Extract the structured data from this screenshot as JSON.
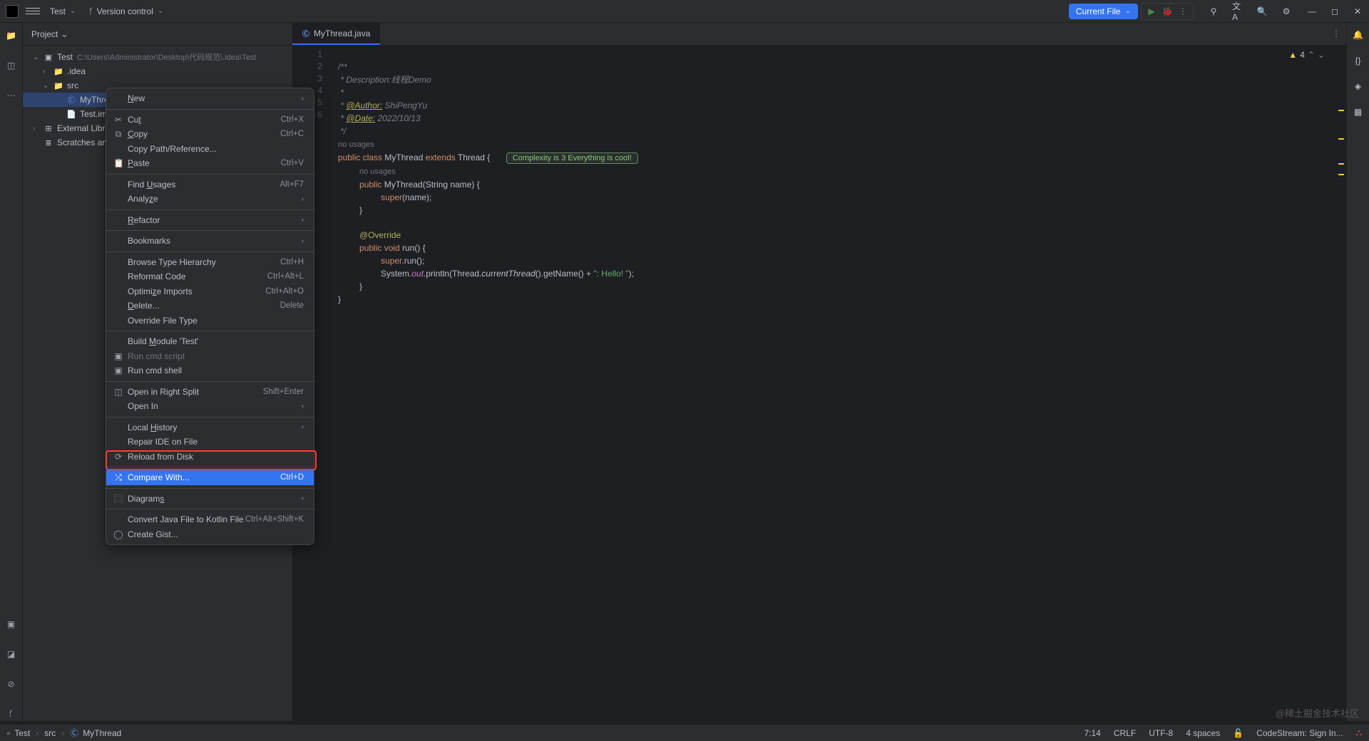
{
  "titlebar": {
    "project_name": "Test",
    "vcs_label": "Version control",
    "run_config": "Current File"
  },
  "panel": {
    "title": "Project"
  },
  "tree": {
    "root": "Test",
    "root_path": "C:\\Users\\Administrator\\Desktop\\代码规范\\.idea\\Test",
    "idea": ".idea",
    "src": "src",
    "mythread": "MyThread",
    "testiml": "Test.iml",
    "ext_lib": "External Librari",
    "scratches": "Scratches and"
  },
  "tab": {
    "file": "MyThread.java"
  },
  "problems": {
    "warn_count": "4"
  },
  "code": {
    "l1": "/**",
    "l2a": " * Description:",
    "l2b": "线程Demo",
    "l3": " *",
    "l4a": " * ",
    "l4_ann": "@Author:",
    "l4b": " ShiPengYu",
    "l5a": " * ",
    "l5_ann": "@Date:",
    "l5b": " 2022/10/13",
    "l6": " */",
    "nousage1": "no usages",
    "l8a": "public ",
    "l8b": "class ",
    "l8c": "MyThread ",
    "l8d": "extends ",
    "l8e": "Thread {",
    "complexity": "Complexity is 3 Everything is cool!",
    "nousage2": "no usages",
    "l10a": "public ",
    "l10b": "MyThread",
    "l10c": "(String name) {",
    "l11a": "super",
    "l11b": "(name);",
    "l12": "}",
    "l14a": "@Override",
    "l15a": "public ",
    "l15b": "void ",
    "l15c": "run",
    "l15d": "() {",
    "l16a": "super",
    "l16b": ".run();",
    "l17a": "System.",
    "l17b": "out",
    "l17c": ".println(Thread.",
    "l17d": "currentThread",
    "l17e": "().getName() + ",
    "l17str": "\": Hello! \"",
    "l17f": ");",
    "l18": "}",
    "l19": "}"
  },
  "gutter": {
    "l1": "1",
    "l2": "2",
    "l3": "3",
    "l4": "4",
    "l5": "5",
    "l6": "6"
  },
  "context_menu": {
    "new": "New",
    "cut": "Cut",
    "cut_sc": "Ctrl+X",
    "copy": "Copy",
    "copy_sc": "Ctrl+C",
    "copy_path": "Copy Path/Reference...",
    "paste": "Paste",
    "paste_sc": "Ctrl+V",
    "find_usages": "Find Usages",
    "find_usages_sc": "Alt+F7",
    "analyze": "Analyze",
    "refactor": "Refactor",
    "bookmarks": "Bookmarks",
    "browse_type": "Browse Type Hierarchy",
    "browse_type_sc": "Ctrl+H",
    "reformat": "Reformat Code",
    "reformat_sc": "Ctrl+Alt+L",
    "optimize": "Optimize Imports",
    "optimize_sc": "Ctrl+Alt+O",
    "delete": "Delete...",
    "delete_sc": "Delete",
    "override": "Override File Type",
    "build_module": "Build Module 'Test'",
    "run_script": "Run cmd script",
    "run_shell": "Run cmd shell",
    "open_split": "Open in Right Split",
    "open_split_sc": "Shift+Enter",
    "open_in": "Open In",
    "local_history": "Local History",
    "repair": "Repair IDE on File",
    "reload": "Reload from Disk",
    "compare": "Compare With...",
    "compare_sc": "Ctrl+D",
    "diagrams": "Diagrams",
    "convert": "Convert Java File to Kotlin File",
    "convert_sc": "Ctrl+Alt+Shift+K",
    "gist": "Create Gist..."
  },
  "statusbar": {
    "crumb1": "Test",
    "crumb2": "src",
    "crumb3": "MyThread",
    "pos": "7:14",
    "eol": "CRLF",
    "enc": "UTF-8",
    "indent": "4 spaces",
    "codestream": "CodeStream:  Sign In..."
  },
  "watermark": "@稀土掘金技术社区"
}
